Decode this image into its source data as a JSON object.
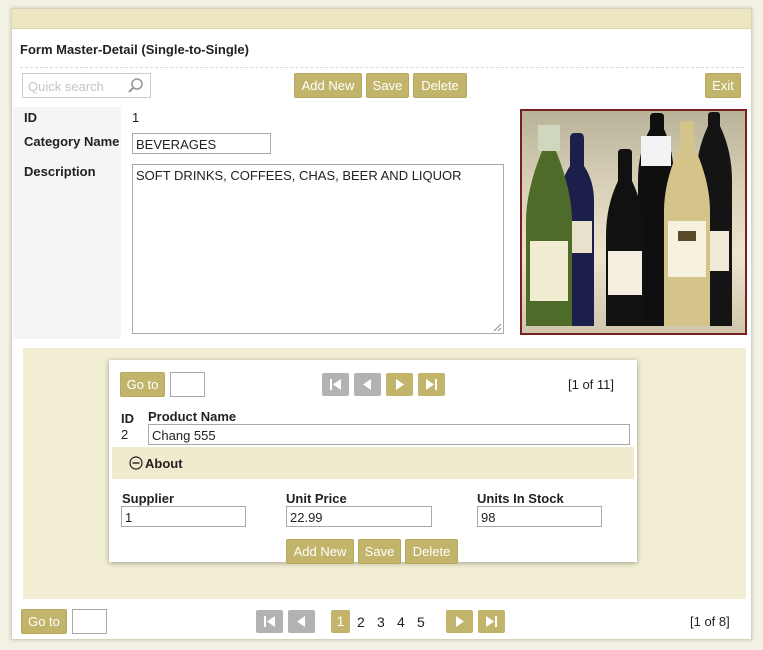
{
  "form": {
    "title": "Form Master-Detail (Single-to-Single)"
  },
  "toolbar": {
    "search_placeholder": "Quick search",
    "add_new": "Add New",
    "save": "Save",
    "delete": "Delete",
    "exit": "Exit"
  },
  "master": {
    "id_label": "ID",
    "id_value": "1",
    "category_name_label": "Category Name",
    "category_name_value": "BEVERAGES",
    "description_label": "Description",
    "description_value": "SOFT DRINKS, COFFEES, CHAS, BEER AND LIQUOR",
    "picture_icon": "wine-bottles-photo"
  },
  "detail": {
    "goto_label": "Go to",
    "goto_value": "",
    "counter": "[1 of 11]",
    "id_label": "ID",
    "id_value": "2",
    "product_name_label": "Product Name",
    "product_name_value": "Chang 555",
    "about_label": "About",
    "supplier_label": "Supplier",
    "supplier_value": "1",
    "unit_price_label": "Unit Price",
    "unit_price_value": "22.99",
    "units_in_stock_label": "Units In Stock",
    "units_in_stock_value": "98",
    "add_new": "Add New",
    "save": "Save",
    "delete": "Delete"
  },
  "pager": {
    "goto_label": "Go to",
    "goto_value": "",
    "pages": [
      "1",
      "2",
      "3",
      "4",
      "5"
    ],
    "active_page": "1",
    "counter": "[1 of 8]"
  },
  "colors": {
    "accent": "#c2b56b",
    "band": "#ece6c1",
    "detail_bg": "#f2eed4",
    "disabled": "#b2b2b2"
  }
}
